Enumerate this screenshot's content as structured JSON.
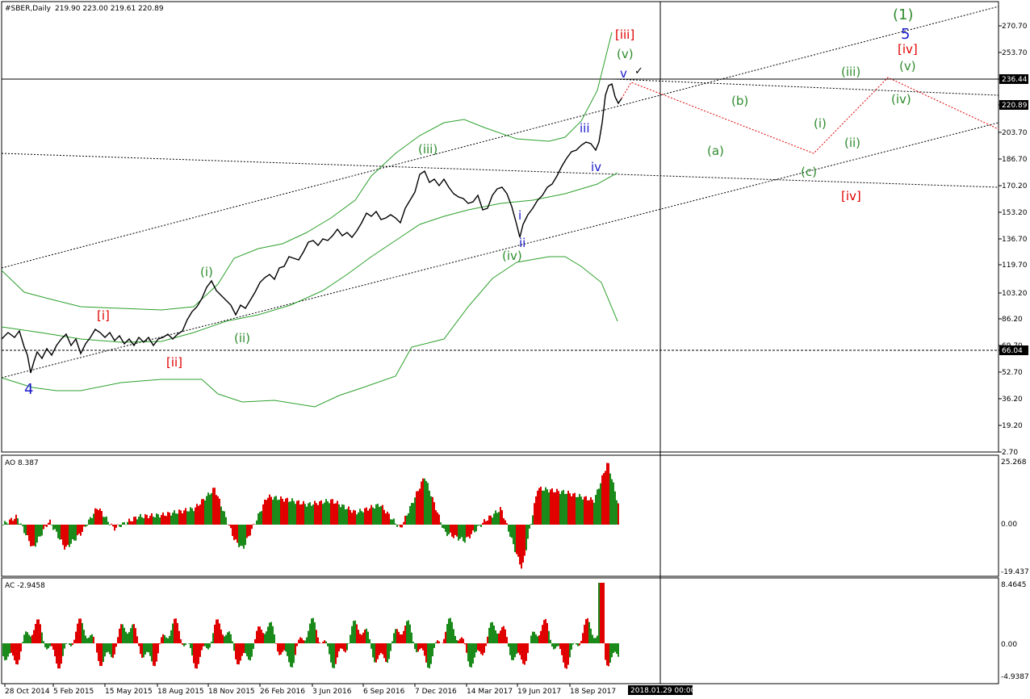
{
  "header": {
    "symbol": "#SBER,Daily",
    "ohlc": "219.90 223.00 219.61 220.89"
  },
  "price_axis": {
    "ticks": [
      "270.70",
      "253.70",
      "236.44",
      "220.89",
      "203.70",
      "186.70",
      "170.20",
      "153.20",
      "136.70",
      "119.70",
      "103.20",
      "86.20",
      "69.70",
      "66.04",
      "52.70",
      "36.20",
      "19.20",
      "2.70"
    ],
    "highlighted": [
      "236.44",
      "220.89",
      "66.04"
    ]
  },
  "ao_panel": {
    "label": "AO 8.387",
    "ticks": [
      "25.268",
      "0.00",
      "-19.437"
    ]
  },
  "ac_panel": {
    "label": "AC -2.9458",
    "ticks": [
      "8.4645",
      "0.00",
      "-4.9387"
    ]
  },
  "time_axis": {
    "ticks": [
      "28 Oct 2014",
      "5 Feb 2015",
      "15 May 2015",
      "18 Aug 2015",
      "18 Nov 2015",
      "26 Feb 2016",
      "3 Jun 2016",
      "6 Sep 2016",
      "7 Dec 2016",
      "14 Mar 2017",
      "19 Jun 2017",
      "18 Sep 2017"
    ],
    "cursor_label": "2018.01.29 00:00"
  },
  "wave_labels": {
    "g_1": "(1)",
    "b_5": "5",
    "r_iv_top": "[iv]",
    "g_v_top": "(v)",
    "r_iii": "[iii]",
    "g_v": "(v)",
    "b_v": "v",
    "check": "✓",
    "g_iii_top": "(iii)",
    "g_b": "(b)",
    "g_iv": "(iv)",
    "g_i": "(i)",
    "b_iii": "iii",
    "g_a": "(a)",
    "g_ii": "(ii)",
    "g_iii": "(iii)",
    "b_iv": "iv",
    "g_c": "(c)",
    "r_iv": "[iv]",
    "b_i": "i",
    "b_ii": "ii",
    "g_iv_low": "(iv)",
    "g_i_low": "(i)",
    "r_i": "[i]",
    "g_ii_low": "(ii)",
    "r_ii": "[ii]",
    "b_4": "4"
  },
  "colors": {
    "green": "#2e8b2e",
    "blue": "#1a1acc",
    "red": "#e00000",
    "ao_up": "#1a8a1a",
    "ao_down": "#e00000",
    "band": "#2ca02c"
  }
}
